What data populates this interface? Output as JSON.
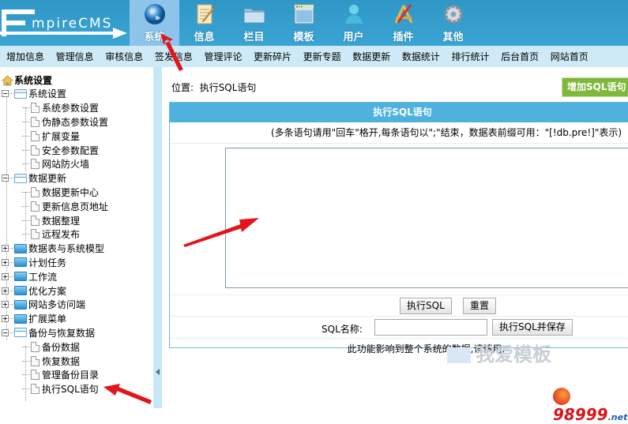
{
  "app": {
    "logo_text": "mpireCMS",
    "logo_letter": "E"
  },
  "top_nav": [
    {
      "label": "系统",
      "icon": "globe-icon",
      "active": true
    },
    {
      "label": "信息",
      "icon": "notepad-pencil-icon",
      "active": false
    },
    {
      "label": "栏目",
      "icon": "folder-icon",
      "active": false
    },
    {
      "label": "模板",
      "icon": "window-template-icon",
      "active": false
    },
    {
      "label": "用户",
      "icon": "user-icon",
      "active": false
    },
    {
      "label": "插件",
      "icon": "tools-icon",
      "active": false
    },
    {
      "label": "其他",
      "icon": "gear-icon",
      "active": false
    }
  ],
  "menu_bar": [
    "增加信息",
    "管理信息",
    "审核信息",
    "签发信息",
    "管理评论",
    "更新碎片",
    "更新专题",
    "数据更新",
    "数据统计",
    "排行统计",
    "后台首页",
    "网站首页"
  ],
  "sidebar": {
    "root": "系统设置",
    "groups": [
      {
        "label": "系统设置",
        "expanded": true,
        "children": [
          "系统参数设置",
          "伪静态参数设置",
          "扩展变量",
          "安全参数配置",
          "网站防火墙"
        ]
      },
      {
        "label": "数据更新",
        "expanded": true,
        "children": [
          "数据更新中心",
          "更新信息页地址",
          "数据整理",
          "远程发布"
        ]
      },
      {
        "label": "数据表与系统模型",
        "expanded": false,
        "children": []
      },
      {
        "label": "计划任务",
        "expanded": false,
        "children": []
      },
      {
        "label": "工作流",
        "expanded": false,
        "children": []
      },
      {
        "label": "优化方案",
        "expanded": false,
        "children": []
      },
      {
        "label": "网站多访问端",
        "expanded": false,
        "children": []
      },
      {
        "label": "扩展菜单",
        "expanded": false,
        "children": []
      },
      {
        "label": "备份与恢复数据",
        "expanded": true,
        "children": [
          "备份数据",
          "恢复数据",
          "管理备份目录",
          "执行SQL语句"
        ]
      }
    ]
  },
  "content": {
    "location_label": "位置:",
    "location_value": "执行SQL语句",
    "add_button": "增加SQL语句",
    "panel_title": "执行SQL语句",
    "hint": "(多条语句请用\"回车\"格开,每条语句以\";\"结束，数据表前缀可用：\"[!db.pre!]\"表示)",
    "sql_textarea_value": "",
    "execute_button": "执行SQL",
    "reset_button": "重置",
    "sql_name_label": "SQL名称:",
    "sql_name_value": "",
    "execute_save_button": "执行SQL并保存",
    "warning": "此功能影响到整个系统的数据,请慎用."
  },
  "watermarks": {
    "center": "我爱模板",
    "brand": "98999",
    "brand_suffix": ".net"
  },
  "colors": {
    "topbar": "#3aa4d3",
    "menubar": "#cdeaf6",
    "panel_header": "#4fb1dd",
    "add_button": "#7fb83a",
    "annotation_arrow": "#e0161c"
  }
}
